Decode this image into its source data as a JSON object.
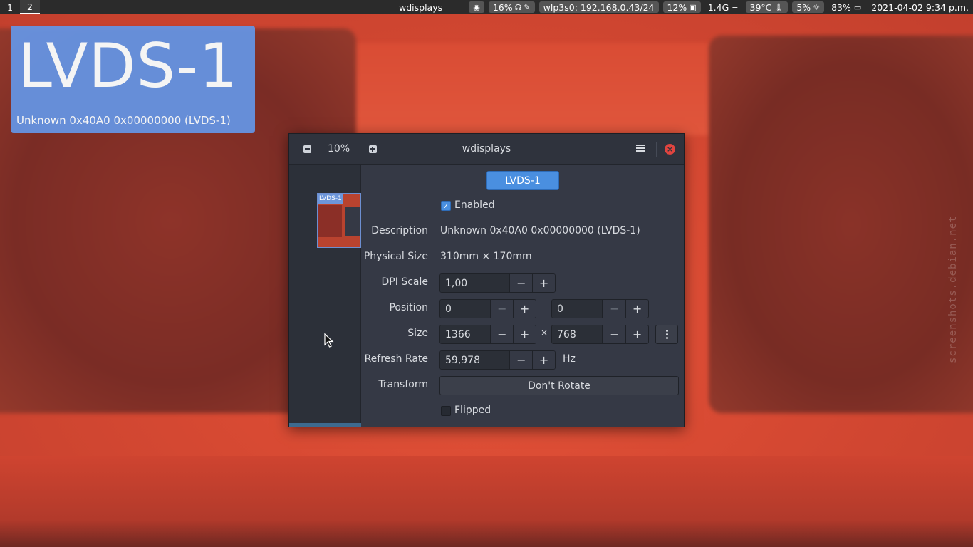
{
  "topbar": {
    "workspaces": [
      "1",
      "2"
    ],
    "active_workspace": "2",
    "focused_title": "wdisplays",
    "status": {
      "volume": "16%",
      "network": "wlp3s0: 192.168.0.43/24",
      "cpu": "12%",
      "memory": "1.4G",
      "temperature": "39°C",
      "brightness": "5%",
      "battery": "83%",
      "datetime": "2021-04-02  9:34 p.m."
    }
  },
  "overlay": {
    "name": "LVDS-1",
    "description": "Unknown 0x40A0 0x00000000 (LVDS-1)"
  },
  "window": {
    "title": "wdisplays",
    "zoom": "10%",
    "preview_label": "LVDS-1",
    "output_button": "LVDS-1",
    "enabled_label": "Enabled",
    "enabled": true,
    "description_label": "Description",
    "description_value": "Unknown 0x40A0 0x00000000 (LVDS-1)",
    "physical_size_label": "Physical Size",
    "physical_size_value": "310mm × 170mm",
    "dpi_scale_label": "DPI Scale",
    "dpi_scale_value": "1,00",
    "position_label": "Position",
    "position_x": "0",
    "position_y": "0",
    "size_label": "Size",
    "size_width": "1366",
    "size_separator": "×",
    "size_height": "768",
    "refresh_rate_label": "Refresh Rate",
    "refresh_rate_value": "59,978",
    "refresh_rate_unit": "Hz",
    "transform_label": "Transform",
    "transform_value": "Don't Rotate",
    "flipped_label": "Flipped",
    "flipped": false
  },
  "watermark": "screenshots.debian.net",
  "colors": {
    "accent": "#4a8fe0",
    "overlay": "#6496e6",
    "close": "#e0443f",
    "window_bg": "#353945",
    "wallpaper": "#d94a32"
  }
}
